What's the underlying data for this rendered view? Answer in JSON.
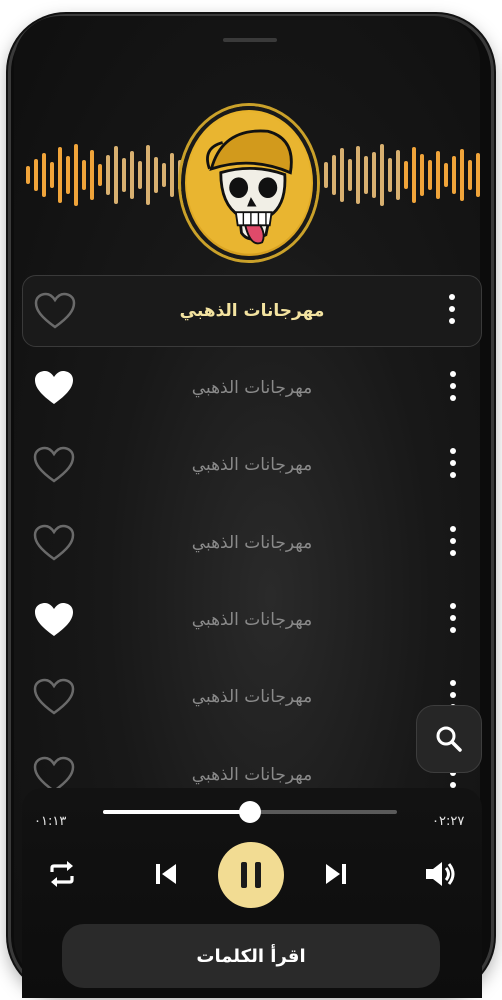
{
  "songs": [
    {
      "title": "مهرجانات الذهبي",
      "liked": false,
      "active": true
    },
    {
      "title": "مهرجانات الذهبي",
      "liked": true,
      "active": false
    },
    {
      "title": "مهرجانات الذهبي",
      "liked": false,
      "active": false
    },
    {
      "title": "مهرجانات الذهبي",
      "liked": false,
      "active": false
    },
    {
      "title": "مهرجانات الذهبي",
      "liked": true,
      "active": false
    },
    {
      "title": "مهرجانات الذهبي",
      "liked": false,
      "active": false
    },
    {
      "title": "مهرجانات الذهبي",
      "liked": false,
      "active": false
    }
  ],
  "player": {
    "elapsed": "٠١:١٣",
    "total": "٠٢:٢٧",
    "progress": 0.5,
    "lyrics_label": "اقرأ الكلمات"
  },
  "icons": {
    "repeat": "repeat-icon",
    "previous": "skip-previous-icon",
    "pause": "pause-icon",
    "next": "skip-next-icon",
    "volume": "volume-icon",
    "search": "search-icon",
    "more": "more-vertical-icon",
    "heart": "heart-icon"
  },
  "colors": {
    "accent": "#f2dc93",
    "active_title": "#f3e3a0",
    "wave_gold": "#f0a43a"
  }
}
